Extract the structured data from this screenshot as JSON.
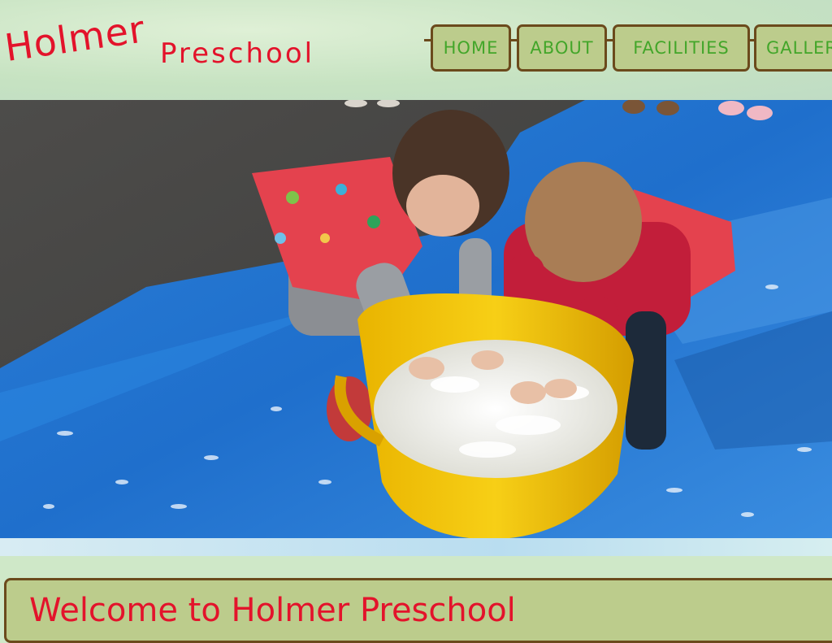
{
  "logo": {
    "main": "Holmer",
    "sub": "Preschool"
  },
  "nav": {
    "items": [
      {
        "label": "HOME"
      },
      {
        "label": "ABOUT"
      },
      {
        "label": "FACILITIES"
      },
      {
        "label": "GALLER"
      }
    ]
  },
  "hero": {
    "description": "Two preschool children playing with feathers in a yellow tub on a blue tarp"
  },
  "welcome": {
    "title": "Welcome to Holmer Preschool"
  },
  "colors": {
    "brand_red": "#e3132b",
    "nav_green_text": "#43a62a",
    "nav_bg": "#bccc8c",
    "nav_border": "#6b4a1c",
    "page_bg": "#cfe8c8"
  }
}
